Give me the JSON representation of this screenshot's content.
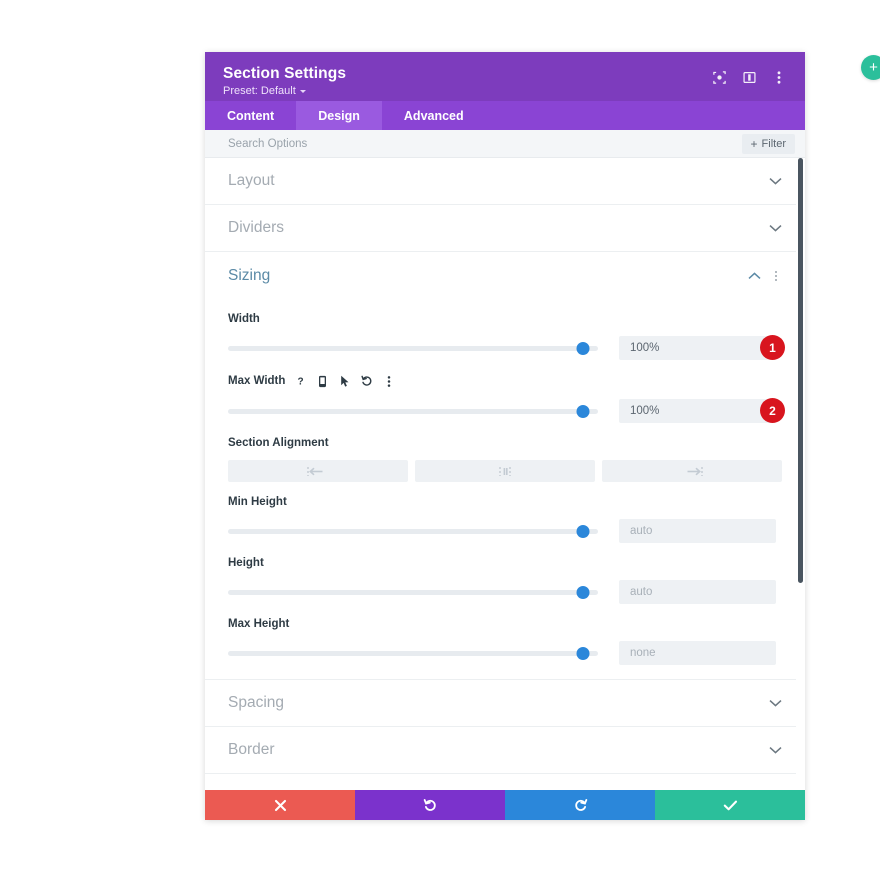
{
  "header": {
    "title": "Section Settings",
    "preset_label": "Preset: Default",
    "icons": [
      {
        "name": "focus-target-icon"
      },
      {
        "name": "panel-layout-icon"
      },
      {
        "name": "more-options-icon"
      }
    ]
  },
  "tabs": [
    {
      "label": "Content",
      "active": false
    },
    {
      "label": "Design",
      "active": true
    },
    {
      "label": "Advanced",
      "active": false
    }
  ],
  "search": {
    "placeholder": "Search Options",
    "value": "",
    "filter_label": "Filter",
    "filter_plus": "+"
  },
  "sections": [
    {
      "title": "Layout",
      "state": "collapsed"
    },
    {
      "title": "Dividers",
      "state": "collapsed"
    },
    {
      "title": "Sizing",
      "state": "expanded"
    },
    {
      "title": "Spacing",
      "state": "collapsed"
    },
    {
      "title": "Border",
      "state": "collapsed"
    }
  ],
  "sizing": {
    "title": "Sizing",
    "fields": [
      {
        "label": "Width",
        "value": "100%",
        "placeholder": "",
        "slider_percent": 96,
        "badge": "1",
        "icons": []
      },
      {
        "label": "Max Width",
        "value": "100%",
        "placeholder": "",
        "slider_percent": 96,
        "badge": "2",
        "icons": [
          {
            "name": "help-icon"
          },
          {
            "name": "mobile-device-icon"
          },
          {
            "name": "cursor-pointer-icon"
          },
          {
            "name": "reset-icon"
          },
          {
            "name": "more-options-icon"
          }
        ]
      },
      {
        "label": "Min Height",
        "value": "",
        "placeholder": "auto",
        "slider_percent": 96,
        "badge": "",
        "icons": []
      },
      {
        "label": "Height",
        "value": "",
        "placeholder": "auto",
        "slider_percent": 96,
        "badge": "",
        "icons": []
      },
      {
        "label": "Max Height",
        "value": "",
        "placeholder": "none",
        "slider_percent": 96,
        "badge": "",
        "icons": []
      }
    ],
    "alignment": {
      "label": "Section Alignment",
      "options": [
        {
          "name": "align-left-icon"
        },
        {
          "name": "align-center-icon"
        },
        {
          "name": "align-right-icon"
        }
      ]
    }
  },
  "footer": {
    "buttons": [
      {
        "name": "cancel-button",
        "icon": "close-icon"
      },
      {
        "name": "undo-button",
        "icon": "undo-icon"
      },
      {
        "name": "redo-button",
        "icon": "redo-icon"
      },
      {
        "name": "save-button",
        "icon": "check-icon"
      }
    ]
  },
  "fab": {
    "label": "+"
  },
  "colors": {
    "header_purple": "#7d3cbd",
    "tabs_purple": "#8a44d4",
    "tab_active_purple": "#9a5ae0",
    "accent_blue": "#2b87da",
    "section_open_blue": "#5b8aa6",
    "badge_red": "#d8151e",
    "cancel_red": "#eb5a52",
    "undo_purple": "#7b32cc",
    "redo_blue": "#2b87da",
    "save_teal": "#2bbf9b"
  }
}
